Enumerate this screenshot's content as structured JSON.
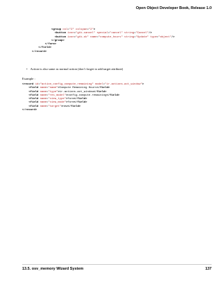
{
  "header": {
    "title": "Open Object Developer Book, Release 1.0"
  },
  "code_top": {
    "lines": [
      "                  <group col=\"2\" colspan=\"2\">",
      "                    <button icon=\"gtk-cancel\" special=\"cancel\" string=\"Cancel\"/>",
      "                    <button icon=\"gtk-ok\" name=\"compute_hours\" string=\"Update\" type=\"object\"/>",
      "                  </group>",
      "              </form>",
      "          </field>",
      "      </record>"
    ]
  },
  "bullet": {
    "text": "Action is also same as normal action (don’t forget to add target attribute)"
  },
  "example_label": "Example :",
  "code_bottom": {
    "lines": [
      "<record id=\"action_config_compute_remaining\" model=\"ir.actions.act_window\">",
      "    <field name=\"name\">Compute Remaining Hours</field>",
      "    <field name=\"type\">ir.actions.act_window</field>",
      "    <field name=\"res_model\">config.compute.remaining</field>",
      "    <field name=\"view_type\">form</field>",
      "    <field name=\"view_mode\">form</field>",
      "    <field name=\"target\">new</field>",
      "</record>"
    ]
  },
  "footer": {
    "section": "13.5.   osv_memory Wizard System",
    "page_number": "137"
  }
}
